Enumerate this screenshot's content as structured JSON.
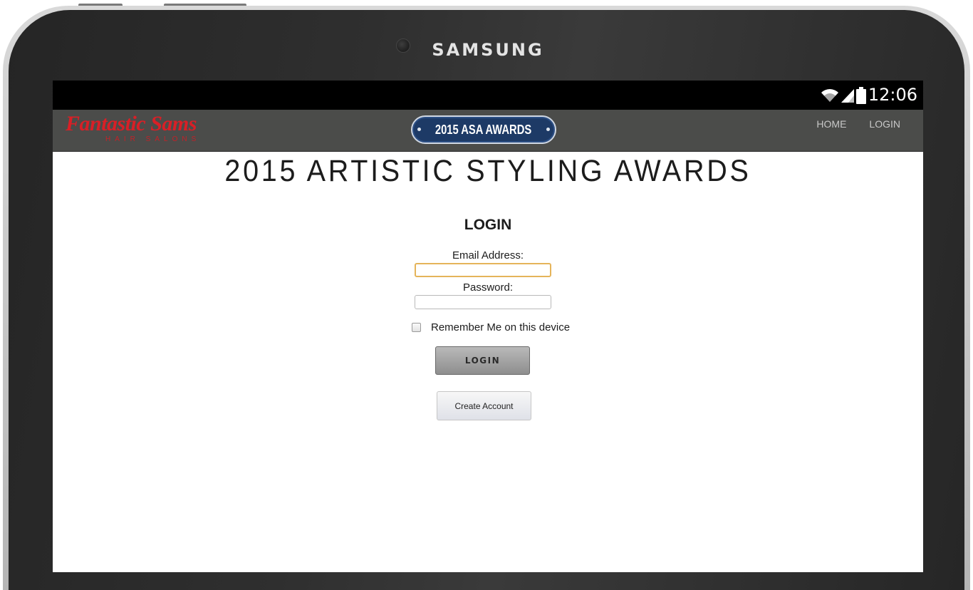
{
  "device": {
    "brand": "SAMSUNG"
  },
  "status_bar": {
    "time": "12:06",
    "icons": [
      "wifi-icon",
      "signal-icon",
      "battery-icon"
    ]
  },
  "header": {
    "logo_main": "Fantastic Sams",
    "logo_sub": "HAIR SALONS",
    "badge": "2015 ASA AWARDS",
    "nav": [
      {
        "label": "HOME"
      },
      {
        "label": "LOGIN"
      }
    ]
  },
  "main": {
    "title": "2015 ARTISTIC STYLING AWARDS",
    "login_heading": "LOGIN",
    "email_label": "Email Address:",
    "email_value": "",
    "password_label": "Password:",
    "password_value": "",
    "remember_label": "Remember Me on this device",
    "remember_checked": false,
    "login_button": "LOGIN",
    "create_account_button": "Create Account"
  },
  "colors": {
    "header_bg": "#4b4c4a",
    "logo_red": "#d91f26",
    "badge_blue": "#1d3a66",
    "input_focus": "#e5b45a"
  }
}
